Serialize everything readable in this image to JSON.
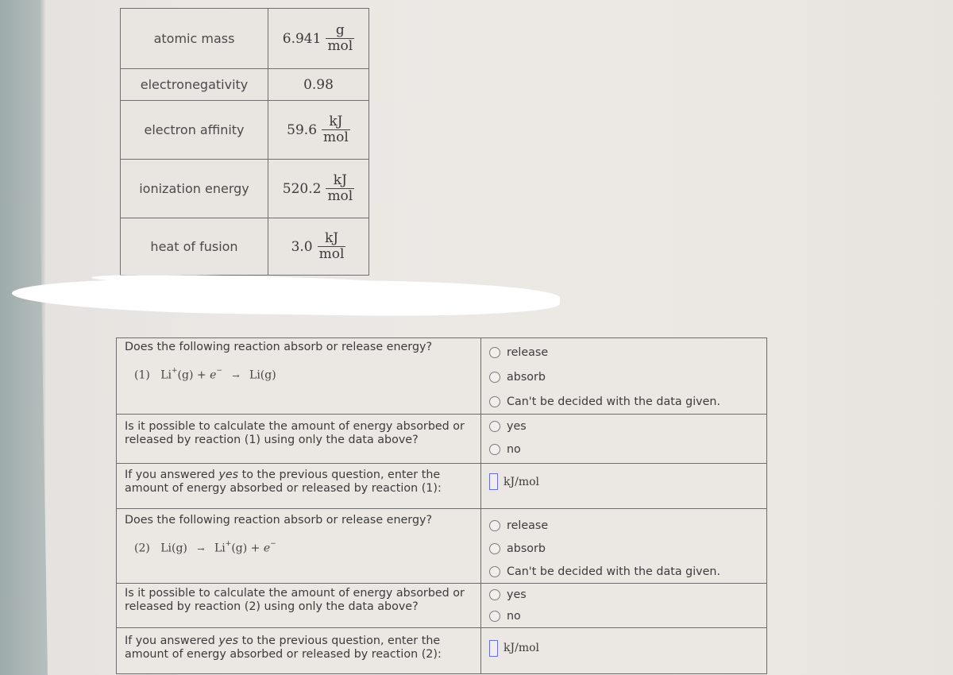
{
  "properties_table": {
    "rows": [
      {
        "label": "atomic mass",
        "value": "6.941",
        "unit_num": "g",
        "unit_den": "mol"
      },
      {
        "label": "electronegativity",
        "value": "0.98",
        "unit_num": "",
        "unit_den": ""
      },
      {
        "label": "electron affinity",
        "value": "59.6",
        "unit_num": "kJ",
        "unit_den": "mol"
      },
      {
        "label": "ionization energy",
        "value": "520.2",
        "unit_num": "kJ",
        "unit_den": "mol"
      },
      {
        "label": "heat of fusion",
        "value": "3.0",
        "unit_num": "kJ",
        "unit_den": "mol"
      }
    ]
  },
  "reactions": [
    {
      "question": "Does the following reaction absorb or release energy?",
      "equation": {
        "number": "(1)",
        "parts": [
          "Li",
          "+",
          "(g)",
          "+",
          "e",
          "−",
          "→",
          "Li(g)"
        ]
      },
      "eq_left": "Li",
      "eq_left_sup": "+",
      "eq_left_state": "(g)",
      "eq_plus": "+",
      "eq_e": "e",
      "eq_e_sup": "−",
      "eq_arrow": "→",
      "eq_right": "Li(g)",
      "options": [
        "release",
        "absorb",
        "Can't be decided with the data given."
      ],
      "calc_question": "Is it possible to calculate the amount of energy absorbed or released by reaction (1) using only the data above?",
      "calc_options": [
        "yes",
        "no"
      ],
      "enter_prefix": "If you answered ",
      "enter_yes": "yes",
      "enter_suffix": " to the previous question, enter the amount of energy absorbed or released by reaction (1):",
      "answer_value": "",
      "answer_unit": "kJ/mol"
    },
    {
      "question": "Does the following reaction absorb or release energy?",
      "equation": {
        "number": "(2)",
        "parts": [
          "Li(g)",
          "→",
          "Li",
          "+",
          "(g)",
          "+",
          "e",
          "−"
        ]
      },
      "eq_left": "Li(g)",
      "eq_arrow": "→",
      "eq_right": "Li",
      "eq_right_sup": "+",
      "eq_right_state": "(g)",
      "eq_plus": "+",
      "eq_e": "e",
      "eq_e_sup": "−",
      "options": [
        "release",
        "absorb",
        "Can't be decided with the data given."
      ],
      "calc_question": "Is it possible to calculate the amount of energy absorbed or released by reaction (2) using only the data above?",
      "calc_options": [
        "yes",
        "no"
      ],
      "enter_prefix": "If you answered ",
      "enter_yes": "yes",
      "enter_suffix": " to the previous question, enter the amount of energy absorbed or released by reaction (2):",
      "answer_value": "",
      "answer_unit": "kJ/mol"
    }
  ]
}
